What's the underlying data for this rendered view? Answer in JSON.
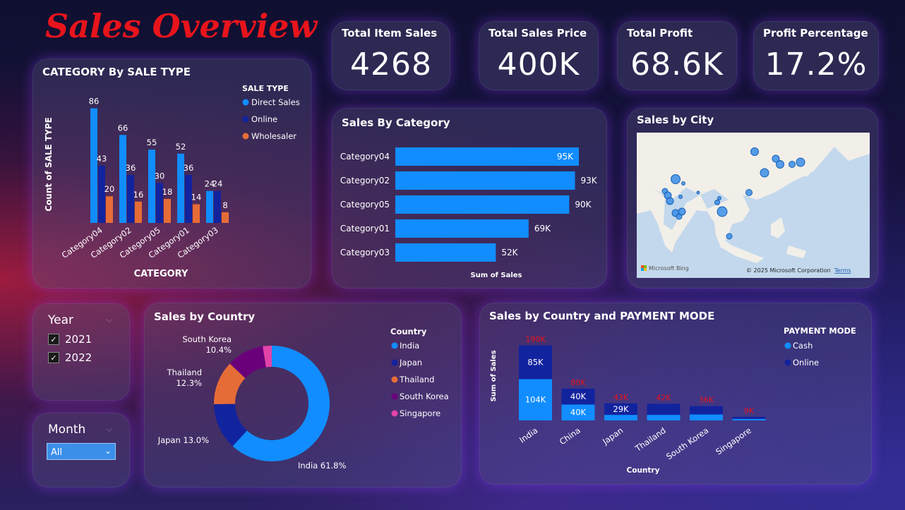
{
  "title": "Sales Overview",
  "kpis": [
    {
      "label": "Total Item Sales",
      "value": "4268"
    },
    {
      "label": "Total Sales Price",
      "value": "400K"
    },
    {
      "label": "Total Profit",
      "value": "68.6K"
    },
    {
      "label": "Profit Percentage",
      "value": "17.2%"
    }
  ],
  "filters": {
    "year": {
      "label": "Year",
      "options": [
        "2021",
        "2022"
      ],
      "checked": [
        true,
        true
      ]
    },
    "month": {
      "label": "Month",
      "selected": "All"
    }
  },
  "map": {
    "title": "Sales by City",
    "logo": "Microsoft Bing",
    "copyright": "© 2025 Microsoft Corporation",
    "terms": "Terms"
  },
  "colors": {
    "direct": "#118dff",
    "online": "#12239e",
    "wholesaler": "#e66c37",
    "india": "#118dff",
    "japan": "#12239e",
    "thailand": "#e66c37",
    "south_korea": "#6b007b",
    "singapore": "#e044a7",
    "label_red": "#e8141c"
  },
  "chart_data": [
    {
      "id": "category_by_sale_type",
      "type": "bar",
      "title": "CATEGORY By SALE TYPE",
      "xlabel": "CATEGORY",
      "ylabel": "Count of SALE TYPE",
      "legend_title": "SALE TYPE",
      "legend_position": "top-right",
      "categories": [
        "Category04",
        "Category02",
        "Category05",
        "Category01",
        "Category03"
      ],
      "series": [
        {
          "name": "Direct Sales",
          "values": [
            86,
            66,
            55,
            52,
            24
          ]
        },
        {
          "name": "Online",
          "values": [
            43,
            36,
            30,
            36,
            24
          ]
        },
        {
          "name": "Wholesaler",
          "values": [
            20,
            16,
            18,
            14,
            8
          ]
        }
      ],
      "ylim": [
        0,
        90
      ]
    },
    {
      "id": "sales_by_category",
      "type": "bar",
      "orientation": "horizontal",
      "title": "Sales By Category",
      "xlabel": "Sum of Sales",
      "categories": [
        "Category04",
        "Category02",
        "Category05",
        "Category01",
        "Category03"
      ],
      "values": [
        95,
        93,
        90,
        69,
        52
      ],
      "labels": [
        "95K",
        "93K",
        "90K",
        "69K",
        "52K"
      ],
      "xlim": [
        0,
        95
      ]
    },
    {
      "id": "sales_by_country",
      "type": "pie",
      "donut": true,
      "title": "Sales by Country",
      "legend_title": "Country",
      "legend_position": "right",
      "categories": [
        "India",
        "Japan",
        "Thailand",
        "South Korea",
        "Singapore"
      ],
      "values": [
        61.8,
        13.0,
        12.3,
        10.4,
        2.5
      ],
      "labels": [
        "India 61.8%",
        "Japan 13.0%",
        "Thailand\n12.3%",
        "South Korea\n10.4%",
        ""
      ]
    },
    {
      "id": "sales_by_country_payment",
      "type": "bar",
      "stacked": true,
      "title": "Sales by Country and PAYMENT MODE",
      "xlabel": "Country",
      "ylabel": "Sum of Sales",
      "legend_title": "PAYMENT MODE",
      "legend_position": "top-right",
      "categories": [
        "India",
        "China",
        "Japan",
        "Thailand",
        "South Korea",
        "Singapore"
      ],
      "series": [
        {
          "name": "Cash",
          "values": [
            104,
            40,
            14,
            14,
            15,
            4
          ]
        },
        {
          "name": "Online",
          "values": [
            85,
            40,
            29,
            28,
            21,
            5
          ]
        }
      ],
      "segment_labels": {
        "Cash": [
          "104K",
          "40K",
          "",
          "",
          "",
          ""
        ],
        "Online": [
          "85K",
          "40K",
          "29K",
          "",
          "",
          ""
        ]
      },
      "totals": [
        "190K",
        "80K",
        "43K",
        "42K",
        "36K",
        "9K"
      ],
      "ylim": [
        0,
        190
      ]
    }
  ]
}
